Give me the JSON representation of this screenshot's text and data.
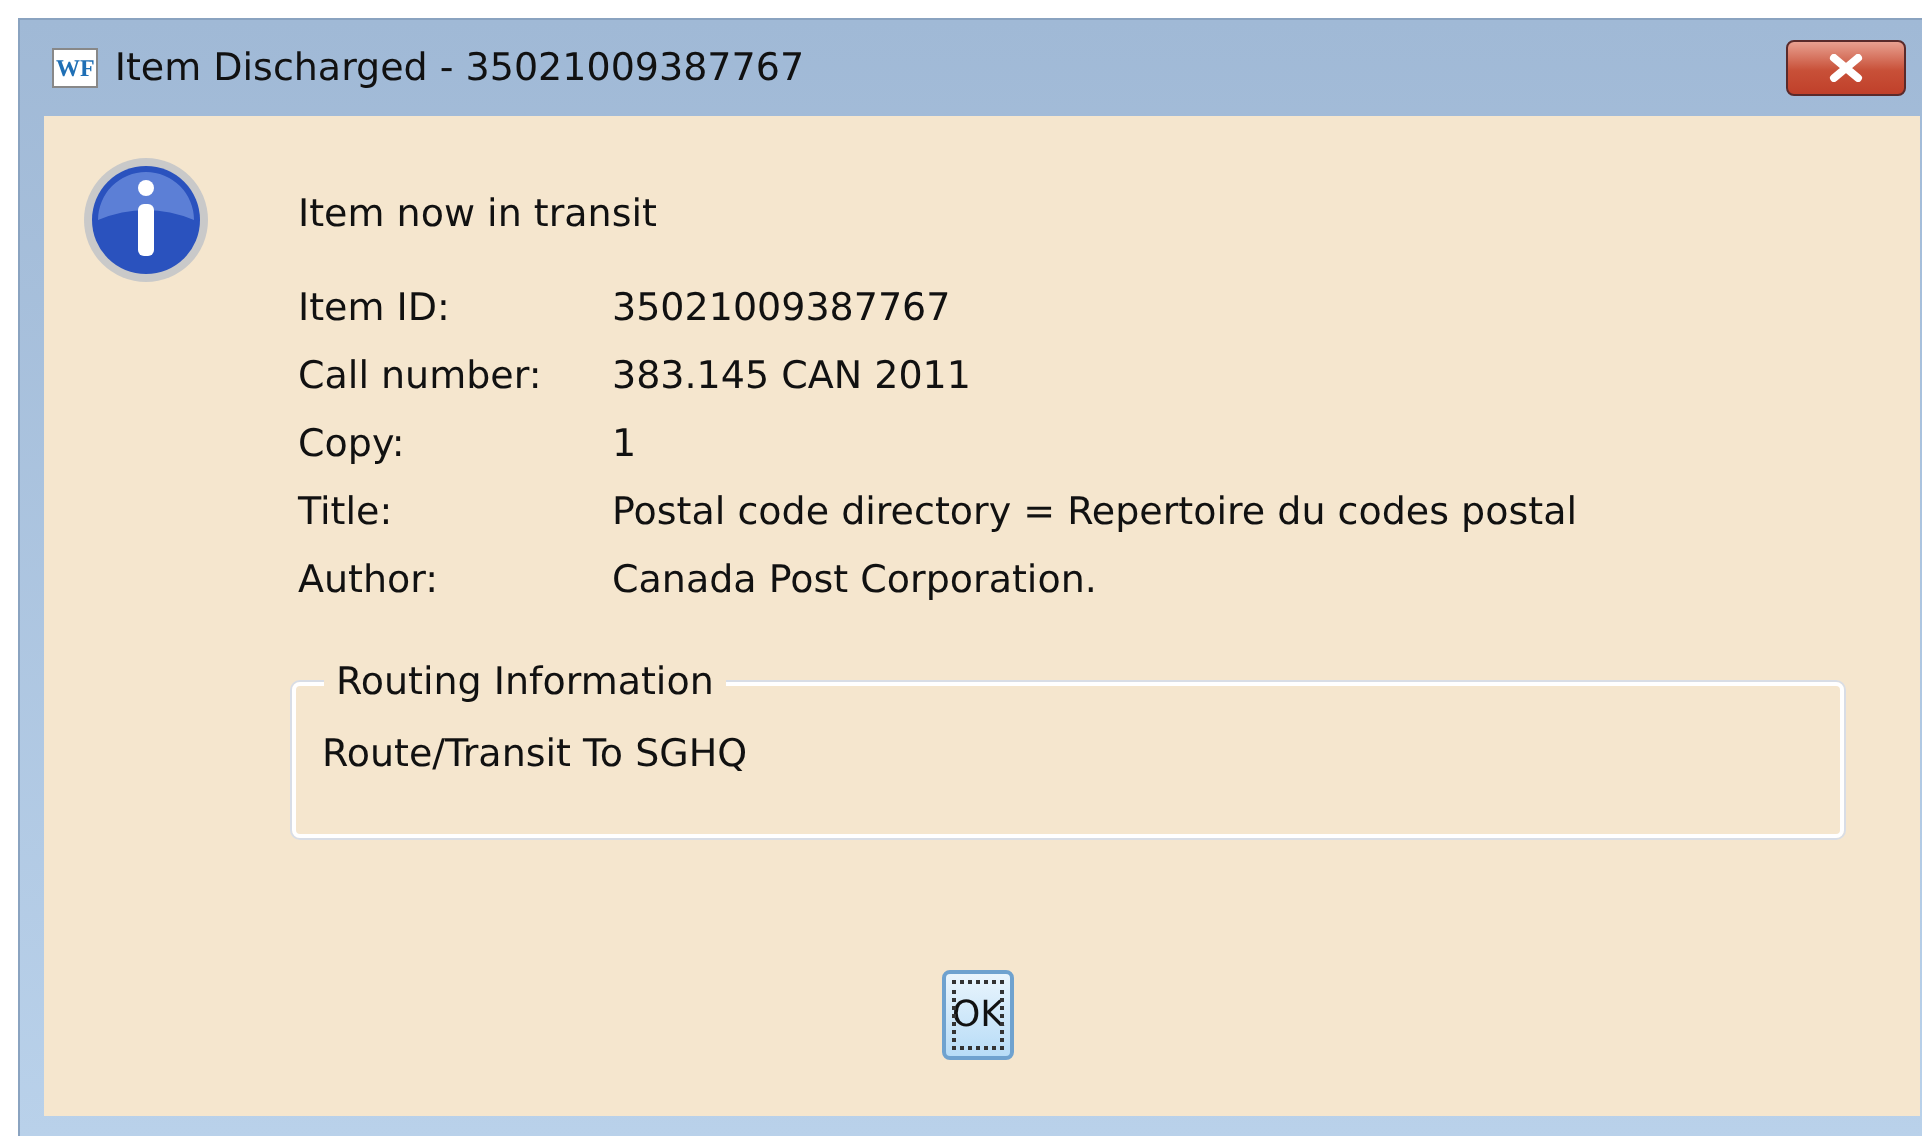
{
  "window": {
    "icon_text": "WF",
    "title": "Item Discharged - 35021009387767"
  },
  "message": "Item now in transit",
  "fields": [
    {
      "label": "Item ID:",
      "value": "35021009387767"
    },
    {
      "label": "Call number:",
      "value": "383.145 CAN 2011"
    },
    {
      "label": "Copy:",
      "value": "1"
    },
    {
      "label": "Title:",
      "value": "Postal code directory = Repertoire du codes postal"
    },
    {
      "label": "Author:",
      "value": "Canada Post Corporation."
    }
  ],
  "routing": {
    "legend": "Routing Information",
    "text": "Route/Transit To SGHQ"
  },
  "buttons": [
    {
      "label": "OK",
      "focused": true
    }
  ]
}
